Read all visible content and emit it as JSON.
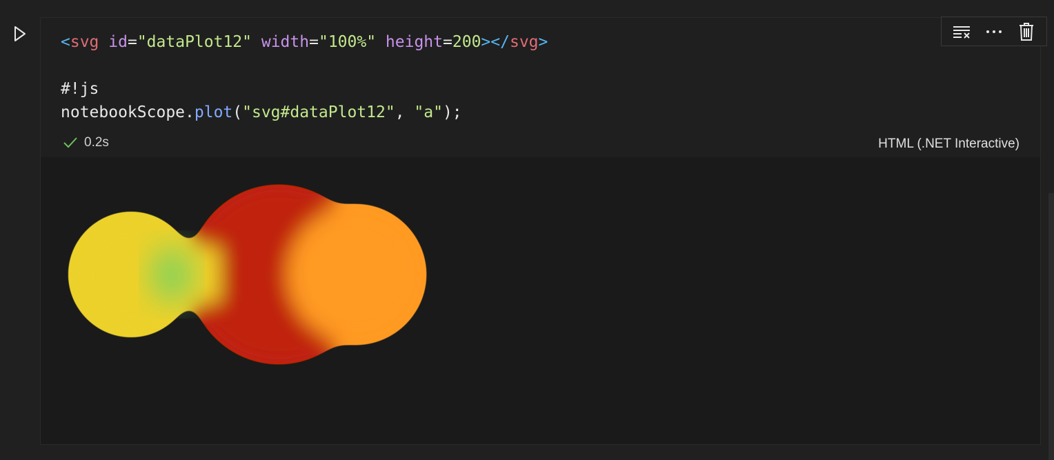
{
  "cell": {
    "code_lines": [
      [
        {
          "t": "<",
          "c": "bracket"
        },
        {
          "t": "svg",
          "c": "tag"
        },
        {
          "t": " ",
          "c": "plain"
        },
        {
          "t": "id",
          "c": "attr"
        },
        {
          "t": "=",
          "c": "plain"
        },
        {
          "t": "\"dataPlot12\"",
          "c": "str"
        },
        {
          "t": " ",
          "c": "plain"
        },
        {
          "t": "width",
          "c": "attr"
        },
        {
          "t": "=",
          "c": "plain"
        },
        {
          "t": "\"100%\"",
          "c": "str"
        },
        {
          "t": " ",
          "c": "plain"
        },
        {
          "t": "height",
          "c": "attr"
        },
        {
          "t": "=",
          "c": "plain"
        },
        {
          "t": "200",
          "c": "str"
        },
        {
          "t": "></",
          "c": "bracket"
        },
        {
          "t": "svg",
          "c": "tag"
        },
        {
          "t": ">",
          "c": "bracket"
        }
      ],
      [],
      [
        {
          "t": "#!js",
          "c": "plain"
        }
      ],
      [
        {
          "t": "notebookScope",
          "c": "plain"
        },
        {
          "t": ".",
          "c": "plain"
        },
        {
          "t": "plot",
          "c": "fn"
        },
        {
          "t": "(",
          "c": "plain"
        },
        {
          "t": "\"svg#dataPlot12\"",
          "c": "str"
        },
        {
          "t": ", ",
          "c": "plain"
        },
        {
          "t": "\"a\"",
          "c": "str"
        },
        {
          "t": ");",
          "c": "plain"
        }
      ]
    ],
    "status": {
      "time": "0.2s",
      "success": true
    },
    "kernel": "HTML (.NET Interactive)"
  },
  "toolbar": {
    "icons": [
      "clear-output-icon",
      "more-icon",
      "delete-icon"
    ]
  },
  "output": {
    "blobs": [
      {
        "color": "#ecd12c",
        "name": "yellow"
      },
      {
        "color": "#7ed35f",
        "name": "green"
      },
      {
        "color": "#c0210e",
        "name": "red"
      },
      {
        "color": "#ff9a20",
        "name": "orange"
      }
    ]
  },
  "colors": {
    "background": "#202020",
    "cell_bg": "#1f1f1f",
    "output_bg": "#1a1a1a",
    "success": "#6dbf5b"
  }
}
